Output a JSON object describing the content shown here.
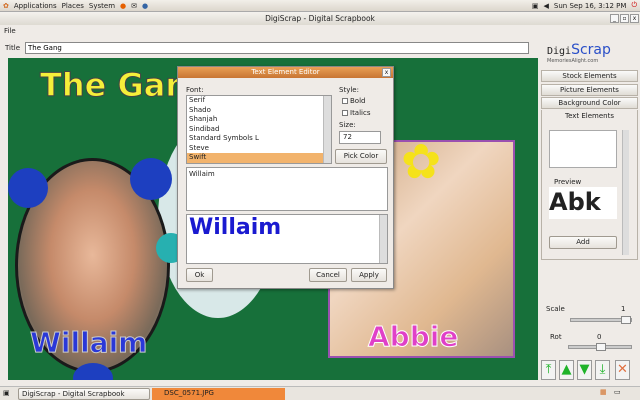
{
  "top_panel": {
    "menus": [
      "Applications",
      "Places",
      "System"
    ],
    "clock": "Sun Sep 16,  3:12 PM"
  },
  "window": {
    "title": "DigiScrap - Digital Scrapbook",
    "menu": [
      "File"
    ]
  },
  "title_field": {
    "label": "Title",
    "value": "The Gang"
  },
  "logo": {
    "text": "DigiScrap",
    "tagline": "MemoriesAlight.com"
  },
  "canvas": {
    "heading": "The Gang",
    "captions": [
      "Willaim",
      "Abbie"
    ],
    "background_color": "#17703a"
  },
  "dialog": {
    "title": "Text Element Editor",
    "font_label": "Font:",
    "fonts": [
      "Serif",
      "Shado",
      "Shanjah",
      "Sindibad",
      "Standard Symbols L",
      "Steve",
      "Swift"
    ],
    "selected_font": "Swift",
    "style_label": "Style:",
    "bold": "Bold",
    "italics": "Italics",
    "size_label": "Size:",
    "size": "72",
    "pick_color": "Pick Color",
    "text": "Willaim",
    "preview_text": "Willaim",
    "ok": "Ok",
    "cancel": "Cancel",
    "apply": "Apply"
  },
  "sidebar": {
    "tabs": [
      "Stock Elements",
      "Picture Elements",
      "Background Color",
      "Text Elements"
    ],
    "preview_label": "Preview",
    "preview_text": "Abk",
    "add": "Add",
    "scale_label": "Scale",
    "scale_value": "1",
    "rot_label": "Rot",
    "rot_value": "0"
  },
  "taskbar": {
    "items": [
      "DigiScrap - Digital Scrapbook",
      "DSC_0571.JPG"
    ]
  }
}
